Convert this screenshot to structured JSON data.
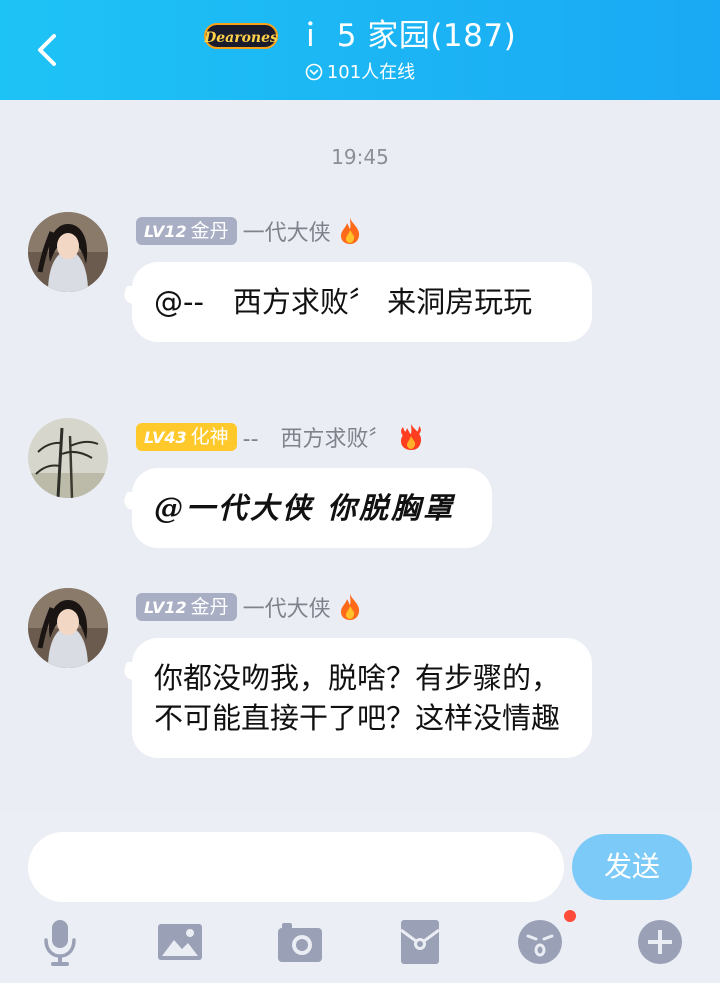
{
  "header": {
    "logo_text": "Dearones",
    "title": "ｉ 5 家园(187)",
    "online_text": "101人在线"
  },
  "timestamp": "19:45",
  "messages": [
    {
      "level": "LV12",
      "rank": "金丹",
      "name": "一代大侠",
      "text": "@--　西方求败〞 来洞房玩玩"
    },
    {
      "level": "LV43",
      "rank": "化神",
      "name": "--　西方求败〞",
      "text": "@一代大侠 你脱胸罩"
    },
    {
      "level": "LV12",
      "rank": "金丹",
      "name": "一代大侠",
      "text": "你都没吻我，脱啥？有步骤的，不可能直接干了吧？这样没情趣"
    }
  ],
  "input": {
    "value": "",
    "send_label": "发送"
  },
  "colors": {
    "header_start": "#1ec3f5",
    "header_end": "#1aa9f4",
    "send_button": "#7ccaf7",
    "level_gray": "#a8aec3",
    "level_gold": "#ffc92c",
    "toolbar_icon": "#9aa0b5",
    "notification_dot": "#ff4b3a"
  },
  "toolbar_icons": [
    "microphone-icon",
    "image-icon",
    "camera-icon",
    "red-packet-icon",
    "emoji-icon",
    "plus-icon"
  ]
}
